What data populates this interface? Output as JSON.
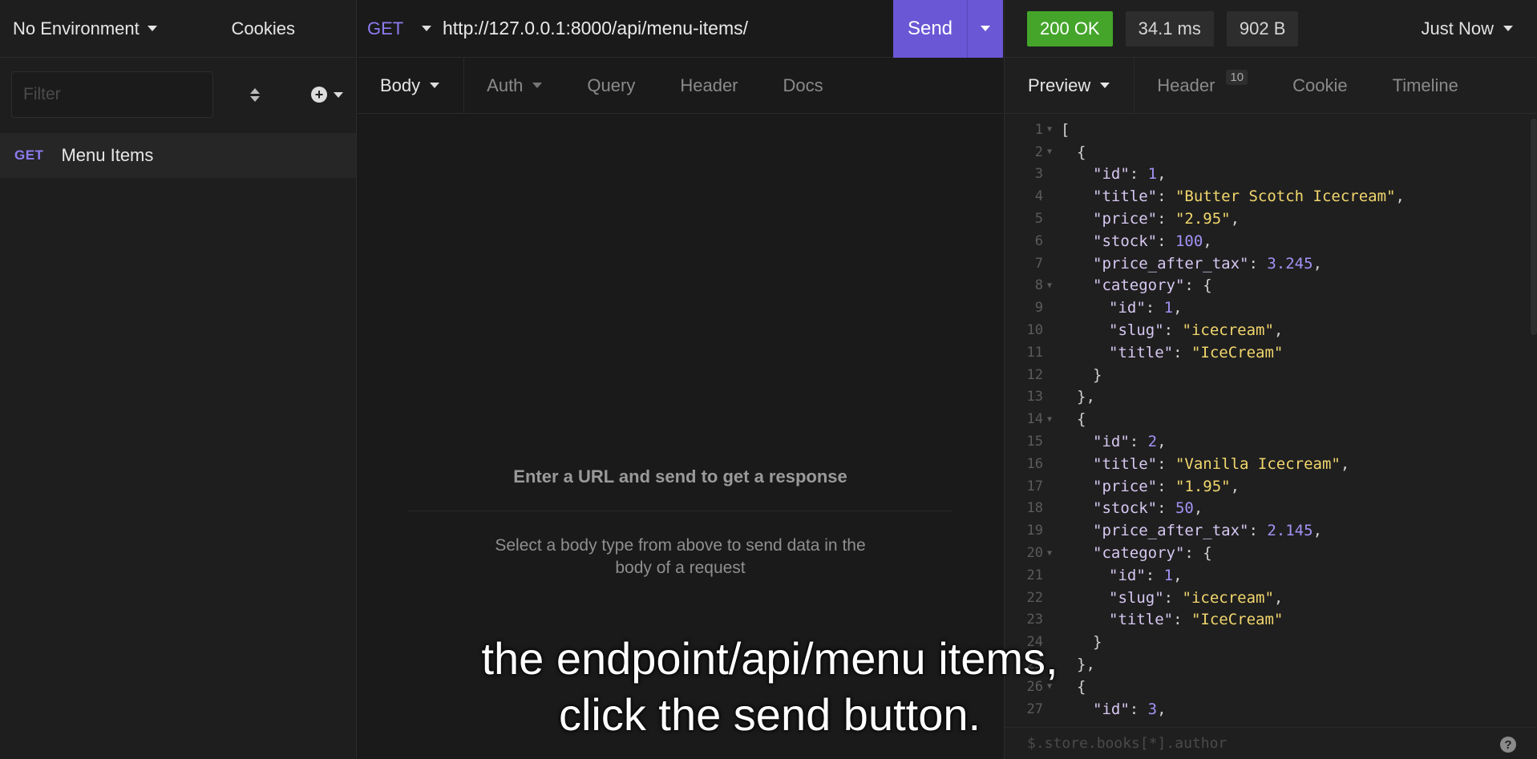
{
  "sidebar": {
    "environment": "No Environment",
    "cookies": "Cookies",
    "filter_placeholder": "Filter",
    "items": [
      {
        "method": "GET",
        "label": "Menu Items"
      }
    ]
  },
  "request": {
    "method": "GET",
    "url": "http://127.0.0.1:8000/api/menu-items/",
    "send_label": "Send",
    "tabs": [
      {
        "label": "Body",
        "dropdown": true
      },
      {
        "label": "Auth",
        "dropdown": true
      },
      {
        "label": "Query"
      },
      {
        "label": "Header"
      },
      {
        "label": "Docs"
      }
    ],
    "empty_title": "Enter a URL and send to get a response",
    "empty_sub": "Select a body type from above to send data in the body of a request"
  },
  "response": {
    "status": "200 OK",
    "time": "34.1 ms",
    "size": "902 B",
    "when": "Just Now",
    "tabs": [
      {
        "label": "Preview",
        "dropdown": true
      },
      {
        "label": "Header",
        "count": "10"
      },
      {
        "label": "Cookie"
      },
      {
        "label": "Timeline"
      }
    ],
    "filter_placeholder": "$.store.books[*].author",
    "help": "?",
    "lines": [
      {
        "n": "1",
        "fold": true,
        "indent": 0,
        "parts": [
          [
            "p",
            "["
          ]
        ]
      },
      {
        "n": "2",
        "fold": true,
        "indent": 1,
        "parts": [
          [
            "p",
            "{"
          ]
        ]
      },
      {
        "n": "3",
        "indent": 2,
        "parts": [
          [
            "k",
            "\"id\""
          ],
          [
            "p",
            ": "
          ],
          [
            "n",
            "1"
          ],
          [
            "p",
            ","
          ]
        ]
      },
      {
        "n": "4",
        "indent": 2,
        "parts": [
          [
            "k",
            "\"title\""
          ],
          [
            "p",
            ": "
          ],
          [
            "s",
            "\"Butter Scotch Icecream\""
          ],
          [
            "p",
            ","
          ]
        ]
      },
      {
        "n": "5",
        "indent": 2,
        "parts": [
          [
            "k",
            "\"price\""
          ],
          [
            "p",
            ": "
          ],
          [
            "s",
            "\"2.95\""
          ],
          [
            "p",
            ","
          ]
        ]
      },
      {
        "n": "6",
        "indent": 2,
        "parts": [
          [
            "k",
            "\"stock\""
          ],
          [
            "p",
            ": "
          ],
          [
            "n",
            "100"
          ],
          [
            "p",
            ","
          ]
        ]
      },
      {
        "n": "7",
        "indent": 2,
        "parts": [
          [
            "k",
            "\"price_after_tax\""
          ],
          [
            "p",
            ": "
          ],
          [
            "n",
            "3.245"
          ],
          [
            "p",
            ","
          ]
        ]
      },
      {
        "n": "8",
        "fold": true,
        "indent": 2,
        "parts": [
          [
            "k",
            "\"category\""
          ],
          [
            "p",
            ": {"
          ]
        ]
      },
      {
        "n": "9",
        "indent": 3,
        "parts": [
          [
            "k",
            "\"id\""
          ],
          [
            "p",
            ": "
          ],
          [
            "n",
            "1"
          ],
          [
            "p",
            ","
          ]
        ]
      },
      {
        "n": "10",
        "indent": 3,
        "parts": [
          [
            "k",
            "\"slug\""
          ],
          [
            "p",
            ": "
          ],
          [
            "s",
            "\"icecream\""
          ],
          [
            "p",
            ","
          ]
        ]
      },
      {
        "n": "11",
        "indent": 3,
        "parts": [
          [
            "k",
            "\"title\""
          ],
          [
            "p",
            ": "
          ],
          [
            "s",
            "\"IceCream\""
          ]
        ]
      },
      {
        "n": "12",
        "indent": 2,
        "parts": [
          [
            "p",
            "}"
          ]
        ]
      },
      {
        "n": "13",
        "indent": 1,
        "parts": [
          [
            "p",
            "},"
          ]
        ]
      },
      {
        "n": "14",
        "fold": true,
        "indent": 1,
        "parts": [
          [
            "p",
            "{"
          ]
        ]
      },
      {
        "n": "15",
        "indent": 2,
        "parts": [
          [
            "k",
            "\"id\""
          ],
          [
            "p",
            ": "
          ],
          [
            "n",
            "2"
          ],
          [
            "p",
            ","
          ]
        ]
      },
      {
        "n": "16",
        "indent": 2,
        "parts": [
          [
            "k",
            "\"title\""
          ],
          [
            "p",
            ": "
          ],
          [
            "s",
            "\"Vanilla Icecream\""
          ],
          [
            "p",
            ","
          ]
        ]
      },
      {
        "n": "17",
        "indent": 2,
        "parts": [
          [
            "k",
            "\"price\""
          ],
          [
            "p",
            ": "
          ],
          [
            "s",
            "\"1.95\""
          ],
          [
            "p",
            ","
          ]
        ]
      },
      {
        "n": "18",
        "indent": 2,
        "parts": [
          [
            "k",
            "\"stock\""
          ],
          [
            "p",
            ": "
          ],
          [
            "n",
            "50"
          ],
          [
            "p",
            ","
          ]
        ]
      },
      {
        "n": "19",
        "indent": 2,
        "parts": [
          [
            "k",
            "\"price_after_tax\""
          ],
          [
            "p",
            ": "
          ],
          [
            "n",
            "2.145"
          ],
          [
            "p",
            ","
          ]
        ]
      },
      {
        "n": "20",
        "fold": true,
        "indent": 2,
        "parts": [
          [
            "k",
            "\"category\""
          ],
          [
            "p",
            ": {"
          ]
        ]
      },
      {
        "n": "21",
        "indent": 3,
        "parts": [
          [
            "k",
            "\"id\""
          ],
          [
            "p",
            ": "
          ],
          [
            "n",
            "1"
          ],
          [
            "p",
            ","
          ]
        ]
      },
      {
        "n": "22",
        "indent": 3,
        "parts": [
          [
            "k",
            "\"slug\""
          ],
          [
            "p",
            ": "
          ],
          [
            "s",
            "\"icecream\""
          ],
          [
            "p",
            ","
          ]
        ]
      },
      {
        "n": "23",
        "indent": 3,
        "parts": [
          [
            "k",
            "\"title\""
          ],
          [
            "p",
            ": "
          ],
          [
            "s",
            "\"IceCream\""
          ]
        ]
      },
      {
        "n": "24",
        "indent": 2,
        "parts": [
          [
            "p",
            "}"
          ]
        ]
      },
      {
        "n": "25",
        "indent": 1,
        "parts": [
          [
            "p",
            "},"
          ]
        ]
      },
      {
        "n": "26",
        "fold": true,
        "indent": 1,
        "parts": [
          [
            "p",
            "{"
          ]
        ]
      },
      {
        "n": "27",
        "indent": 2,
        "parts": [
          [
            "k",
            "\"id\""
          ],
          [
            "p",
            ": "
          ],
          [
            "n",
            "3"
          ],
          [
            "p",
            ","
          ]
        ]
      }
    ]
  },
  "caption": {
    "line1": "the endpoint/api/menu items,",
    "line2": "click the send button."
  }
}
